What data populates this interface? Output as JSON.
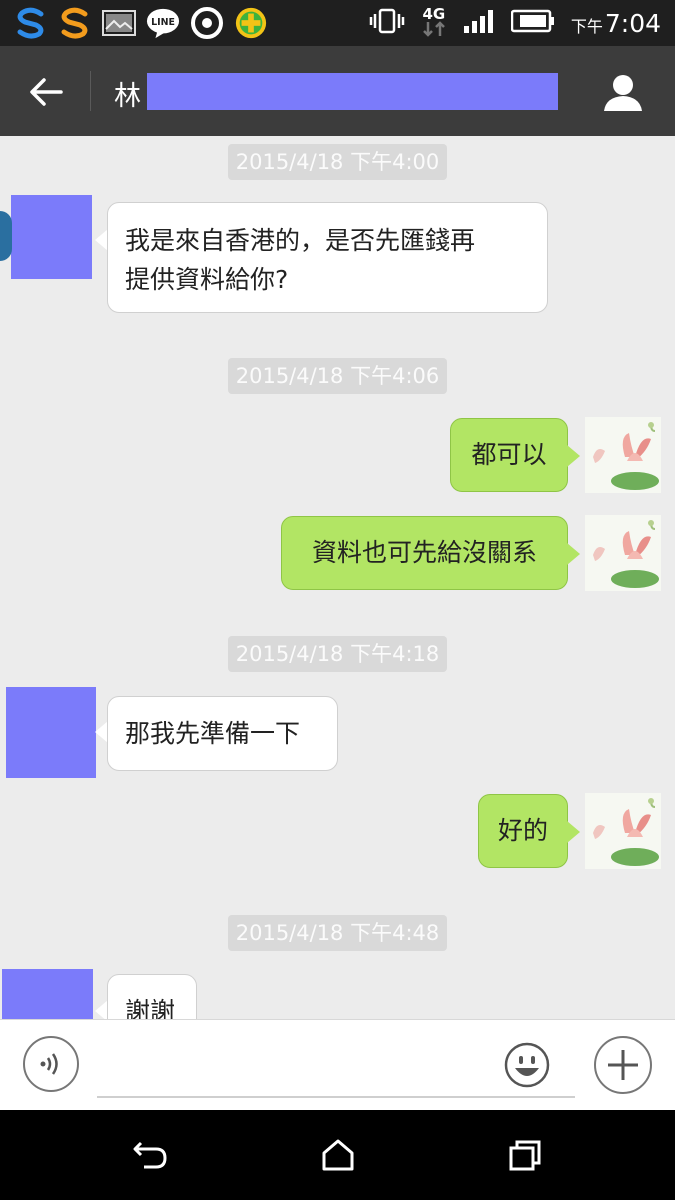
{
  "status_bar": {
    "time_period": "下午",
    "time": "7:04",
    "network": "4G",
    "icons": [
      "s-app-icon-blue",
      "s-app-icon-orange",
      "gallery-notification-icon",
      "line-app-icon",
      "target-notification-icon",
      "plus-app-icon",
      "vibrate-icon",
      "network-4g-icon",
      "signal-icon",
      "battery-icon"
    ],
    "line_label": "LINE"
  },
  "header": {
    "contact_name": "林",
    "icons": [
      "back-arrow-icon",
      "profile-icon"
    ]
  },
  "messages": [
    {
      "type": "timestamp",
      "text": "2015/4/18 下午4:00"
    },
    {
      "type": "incoming",
      "lines": [
        "我是來自香港的，是否先匯錢再",
        "提供資料給你?"
      ]
    },
    {
      "type": "timestamp",
      "text": "2015/4/18 下午4:06"
    },
    {
      "type": "outgoing",
      "text": "都可以"
    },
    {
      "type": "outgoing",
      "text": "資料也可先給沒關系"
    },
    {
      "type": "timestamp",
      "text": "2015/4/18 下午4:18"
    },
    {
      "type": "incoming",
      "text": "那我先準備一下"
    },
    {
      "type": "outgoing",
      "text": "好的"
    },
    {
      "type": "timestamp",
      "text": "2015/4/18 下午4:48"
    },
    {
      "type": "incoming",
      "text": "謝謝"
    }
  ],
  "input_bar": {
    "value": "",
    "placeholder": "",
    "icons": [
      "voice-icon",
      "emoji-icon",
      "plus-icon"
    ]
  },
  "nav_bar": {
    "icons": [
      "nav-back-icon",
      "nav-home-icon",
      "nav-recents-icon"
    ]
  },
  "colors": {
    "header_bg": "#3c3c3c",
    "chat_bg": "#ececec",
    "outgoing_bubble": "#b2e564",
    "incoming_bubble": "#ffffff",
    "redaction": "#7b7bfa"
  }
}
